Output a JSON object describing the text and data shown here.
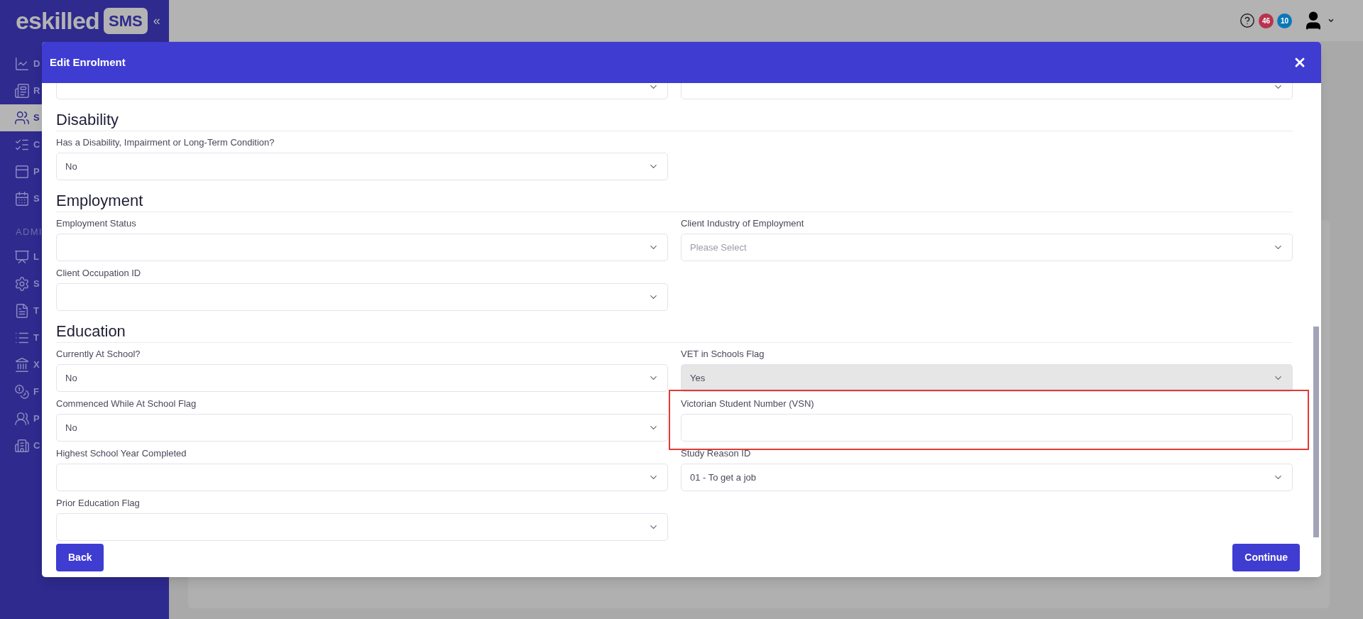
{
  "sidebar": {
    "logo": {
      "wordmark": "eskilled",
      "badge": "SMS"
    },
    "collapse": "«",
    "items": [
      {
        "label": "D",
        "selected": false
      },
      {
        "label": "R",
        "selected": false
      },
      {
        "label": "S",
        "selected": true
      },
      {
        "label": "C",
        "selected": false
      },
      {
        "label": "P",
        "selected": false
      },
      {
        "label": "S",
        "selected": false
      }
    ],
    "admin_heading": "ADMI",
    "admin_items": [
      {
        "label": "L",
        "selected": false
      },
      {
        "label": "S",
        "selected": false
      },
      {
        "label": "T",
        "selected": false
      },
      {
        "label": "T",
        "selected": false
      },
      {
        "label": "X",
        "selected": false
      },
      {
        "label": "F",
        "selected": false
      },
      {
        "label": "P",
        "selected": false
      },
      {
        "label": "C",
        "selected": false
      }
    ]
  },
  "topbar": {
    "badges": [
      {
        "text": "46",
        "color": "#b8334f"
      },
      {
        "text": "10",
        "color": "#0a78b8"
      }
    ]
  },
  "modal": {
    "title": "Edit Enrolment",
    "sections": [
      {
        "title": "Disability",
        "fields": [
          {
            "label": "Has a Disability, Impairment or Long-Term Condition?",
            "value": "No",
            "kind": "select",
            "disabled": false,
            "highlighted": false
          }
        ]
      },
      {
        "title": "Employment",
        "fields": [
          {
            "label": "Employment Status",
            "kind": "select",
            "disabled": false,
            "highlighted": false
          },
          {
            "label": "Client Industry of Employment",
            "placeholder": "Please Select",
            "kind": "select",
            "disabled": false,
            "highlighted": false
          },
          {
            "label": "Client Occupation ID",
            "kind": "select",
            "disabled": false,
            "highlighted": false
          }
        ]
      },
      {
        "title": "Education",
        "fields": [
          {
            "label": "Currently At School?",
            "value": "No",
            "kind": "select",
            "disabled": false,
            "highlighted": false
          },
          {
            "label": "VET in Schools Flag",
            "value": "Yes",
            "kind": "select",
            "disabled": true,
            "highlighted": false
          },
          {
            "label": "Commenced While At School Flag",
            "value": "No",
            "kind": "select",
            "disabled": false,
            "highlighted": false
          },
          {
            "label": "Victorian Student Number (VSN)",
            "kind": "text",
            "disabled": false,
            "highlighted": true
          },
          {
            "label": "Highest School Year Completed",
            "kind": "select",
            "disabled": false,
            "highlighted": false
          },
          {
            "label": "Study Reason ID",
            "value": "01 - To get a job",
            "kind": "select",
            "disabled": false,
            "highlighted": false
          },
          {
            "label": "Prior Education Flag",
            "kind": "select",
            "disabled": false,
            "highlighted": false
          }
        ]
      }
    ],
    "buttons": {
      "back": "Back",
      "continue": "Continue"
    }
  }
}
